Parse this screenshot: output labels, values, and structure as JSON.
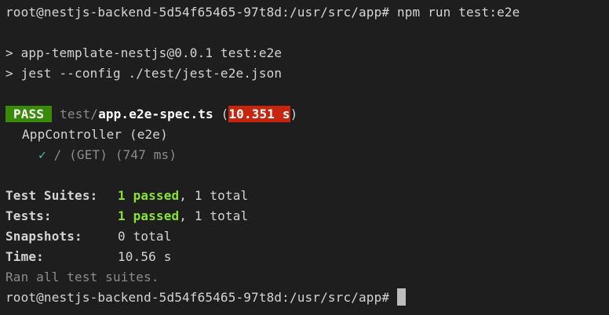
{
  "colors": {
    "background": "#1e1e1e",
    "foreground": "#d4d4d4",
    "pass_badge": "#3a8a0a",
    "time_badge": "#c6250f",
    "passed_text": "#8ae234",
    "dim_text": "#8c8c8c"
  },
  "prompt": {
    "text": "root@nestjs-backend-5d54f65465-97t8d:/usr/src/app# ",
    "command": "npm run test:e2e"
  },
  "npm_output": {
    "line1": "> app-template-nestjs@0.0.1 test:e2e",
    "line2": "> jest --config ./test/jest-e2e.json"
  },
  "result": {
    "status": "PASS",
    "dir": "test/",
    "file": "app.e2e-spec.ts",
    "paren_open": " (",
    "duration": "10.351 s",
    "paren_close": ")"
  },
  "suite": {
    "name": "AppController (e2e)",
    "check_icon": "✓",
    "test_name": " / (GET) (747 ms)"
  },
  "summary": {
    "test_suites_label": "Test Suites:",
    "test_suites_passed": "1 passed",
    "test_suites_total": ", 1 total",
    "tests_label": "Tests:",
    "tests_passed": "1 passed",
    "tests_total": ", 1 total",
    "snapshots_label": "Snapshots:",
    "snapshots_value": "0 total",
    "time_label": "Time:",
    "time_value": "10.56 s",
    "ran_all": "Ran all test suites."
  },
  "final_prompt": {
    "text": "root@nestjs-backend-5d54f65465-97t8d:/usr/src/app#"
  }
}
